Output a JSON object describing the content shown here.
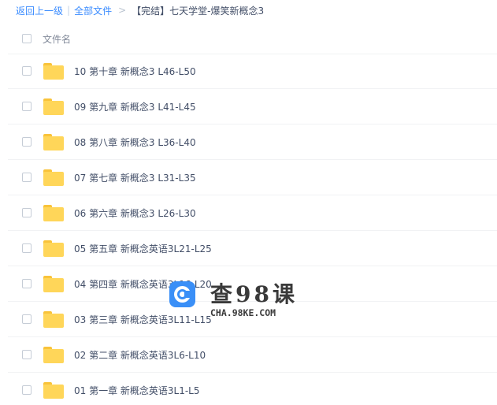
{
  "breadcrumb": {
    "back": "返回上一级",
    "separator": "|",
    "all_files": "全部文件",
    "arrow": ">",
    "current": "【完结】七天学堂-爆笑新概念3"
  },
  "list_header": {
    "column_name": "文件名"
  },
  "files": [
    {
      "name": "10 第十章 新概念3 L46-L50",
      "type": "folder"
    },
    {
      "name": "09 第九章 新概念3 L41-L45",
      "type": "folder"
    },
    {
      "name": "08 第八章 新概念3 L36-L40",
      "type": "folder"
    },
    {
      "name": "07 第七章 新概念3 L31-L35",
      "type": "folder"
    },
    {
      "name": "06 第六章 新概念3 L26-L30",
      "type": "folder"
    },
    {
      "name": "05 第五章 新概念英语3L21-L25",
      "type": "folder"
    },
    {
      "name": "04 第四章 新概念英语3L16-L20",
      "type": "folder"
    },
    {
      "name": "03 第三章 新概念英语3L11-L15",
      "type": "folder"
    },
    {
      "name": "02 第二章 新概念英语3L6-L10",
      "type": "folder"
    },
    {
      "name": "01 第一章 新概念英语3L1-L5",
      "type": "folder"
    }
  ],
  "watermark": {
    "title": "查98课",
    "url": "CHA.98KE.COM"
  },
  "colors": {
    "link": "#3b8cff",
    "text": "#424e67",
    "folder": "#ffd659",
    "folder_tab": "#f9c33a",
    "watermark_logo": "#3a8ff7"
  },
  "icons": {
    "folder": "folder-icon",
    "checkbox": "checkbox-icon",
    "logo": "cha98ke-logo-icon"
  }
}
